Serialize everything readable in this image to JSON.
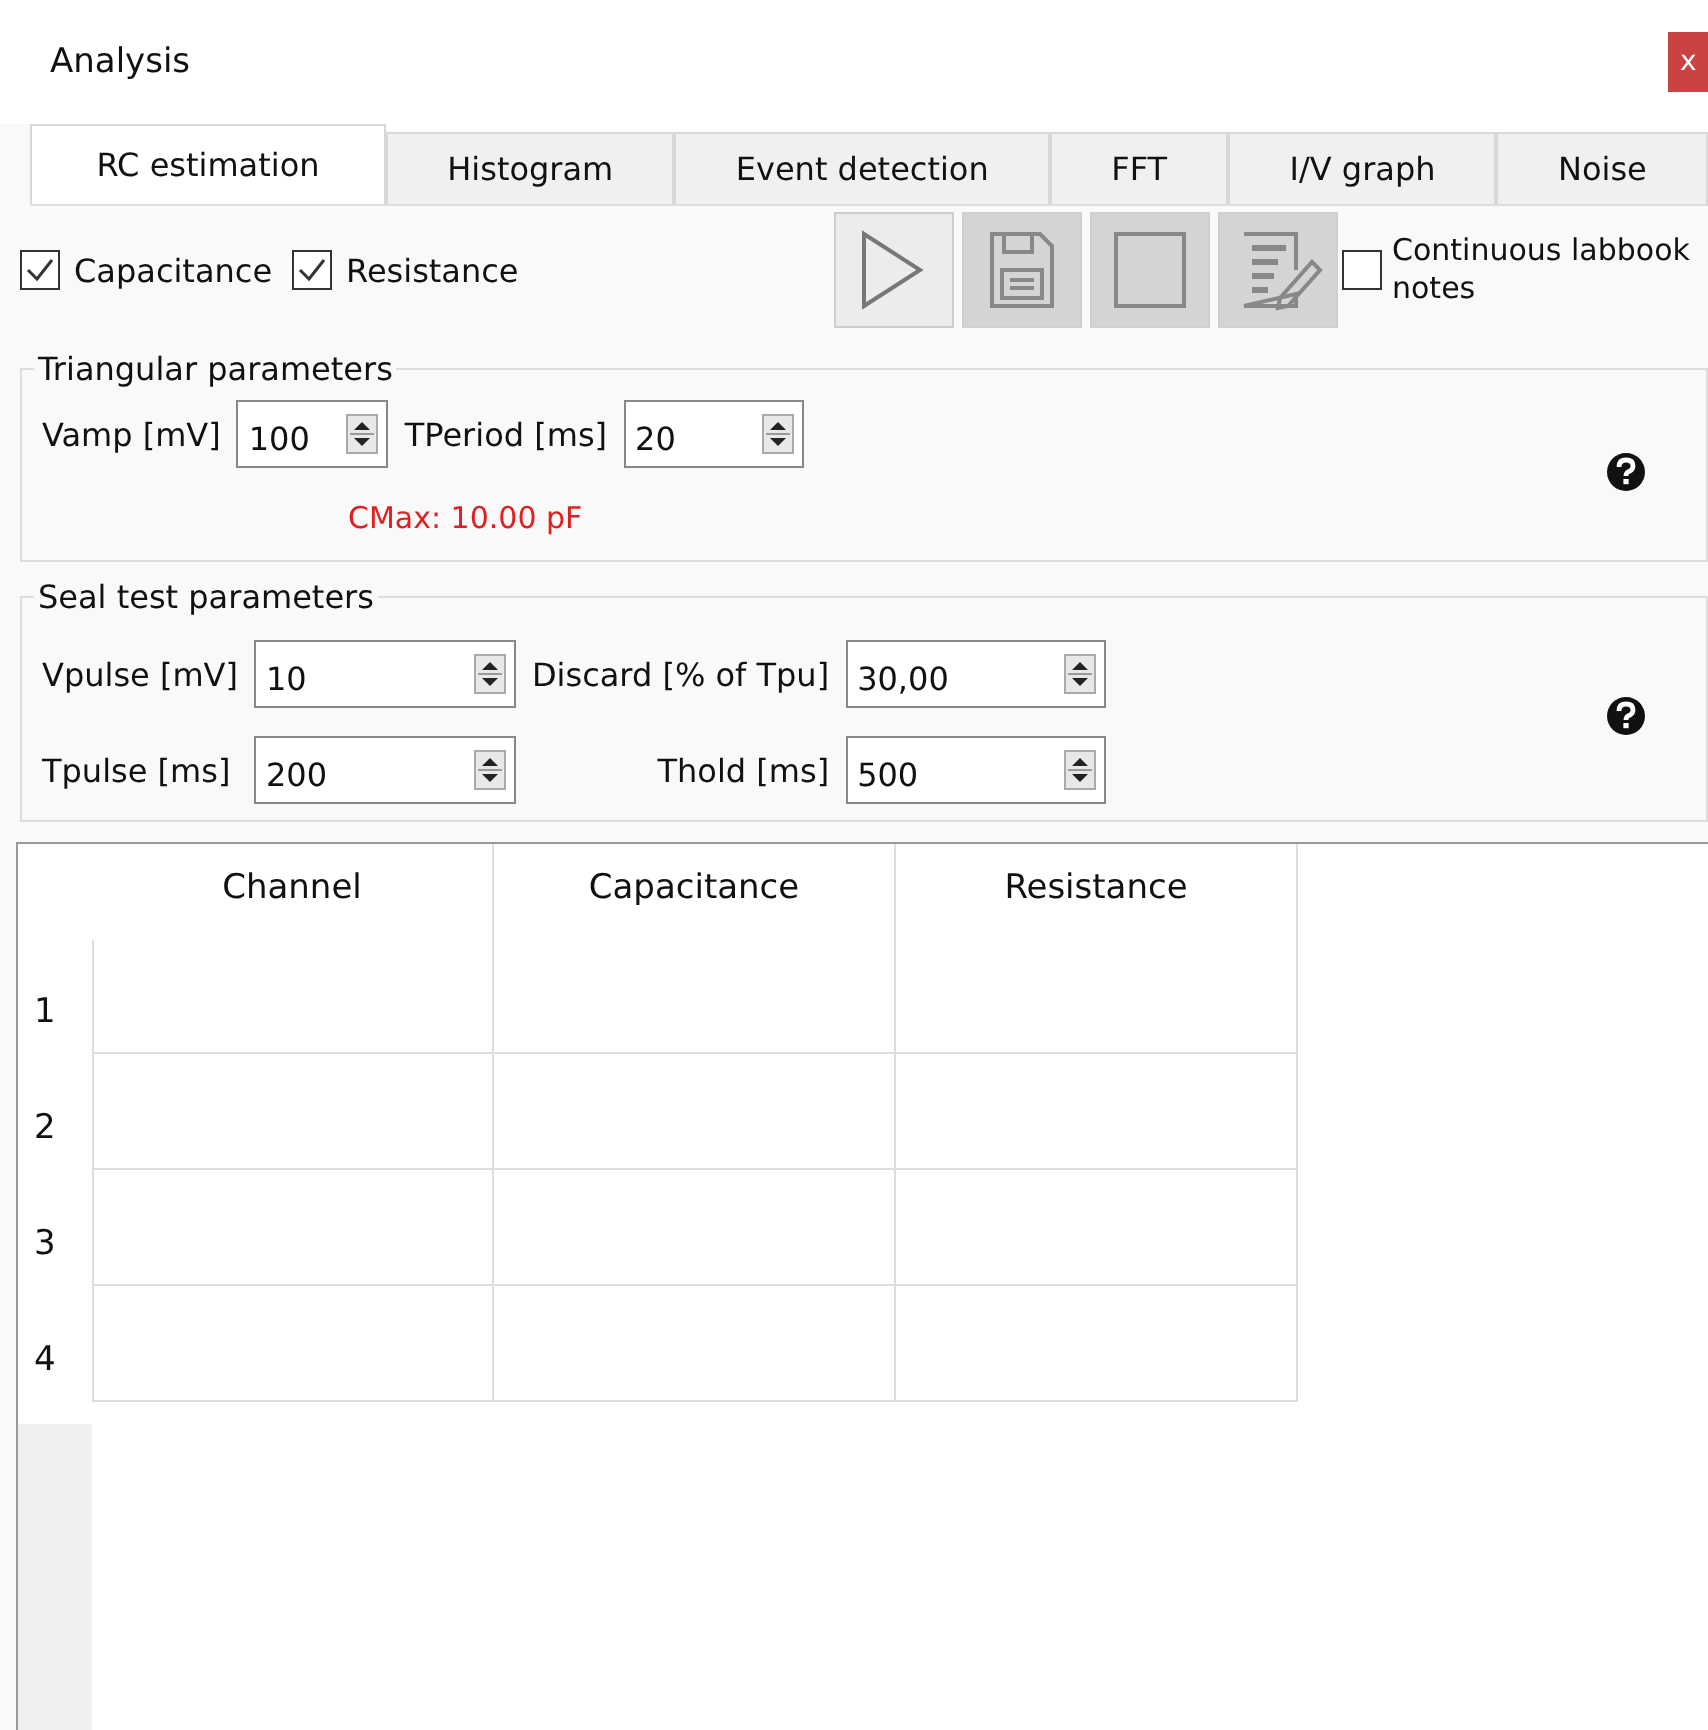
{
  "window": {
    "title": "Analysis",
    "close": "x"
  },
  "tabs": [
    {
      "label": "RC estimation",
      "selected": true
    },
    {
      "label": "Histogram",
      "selected": false
    },
    {
      "label": "Event detection",
      "selected": false
    },
    {
      "label": "FFT",
      "selected": false
    },
    {
      "label": "I/V graph",
      "selected": false
    },
    {
      "label": "Noise",
      "selected": false
    }
  ],
  "options": [
    {
      "label": "Capacitance",
      "checked": true
    },
    {
      "label": "Resistance",
      "checked": true
    }
  ],
  "toolbar": [
    {
      "kind": "run",
      "disabled": false
    },
    {
      "kind": "save",
      "disabled": true
    },
    {
      "kind": "stop",
      "disabled": true
    },
    {
      "kind": "notes",
      "disabled": true
    }
  ],
  "labbook": {
    "label": "Continuous labbook notes",
    "checked": false
  },
  "triangular": {
    "title": "Triangular parameters",
    "fields": [
      {
        "label": "Vamp [mV]",
        "value": "100"
      },
      {
        "label": "TPeriod [ms]",
        "value": "20"
      }
    ],
    "cmax": "CMax: 10.00 pF"
  },
  "seal_test": {
    "title": "Seal test parameters",
    "fields": [
      {
        "label": "Vpulse [mV]",
        "value": "10"
      },
      {
        "label": "Discard [% of Tpu]",
        "value": "30,00"
      },
      {
        "label": "Tpulse [ms]",
        "value": "200"
      },
      {
        "label": "Thold [ms]",
        "value": "500"
      }
    ]
  },
  "table": {
    "columns": [
      "Channel",
      "Capacitance",
      "Resistance"
    ],
    "row_headers": [
      "1",
      "2",
      "3",
      "4"
    ]
  }
}
